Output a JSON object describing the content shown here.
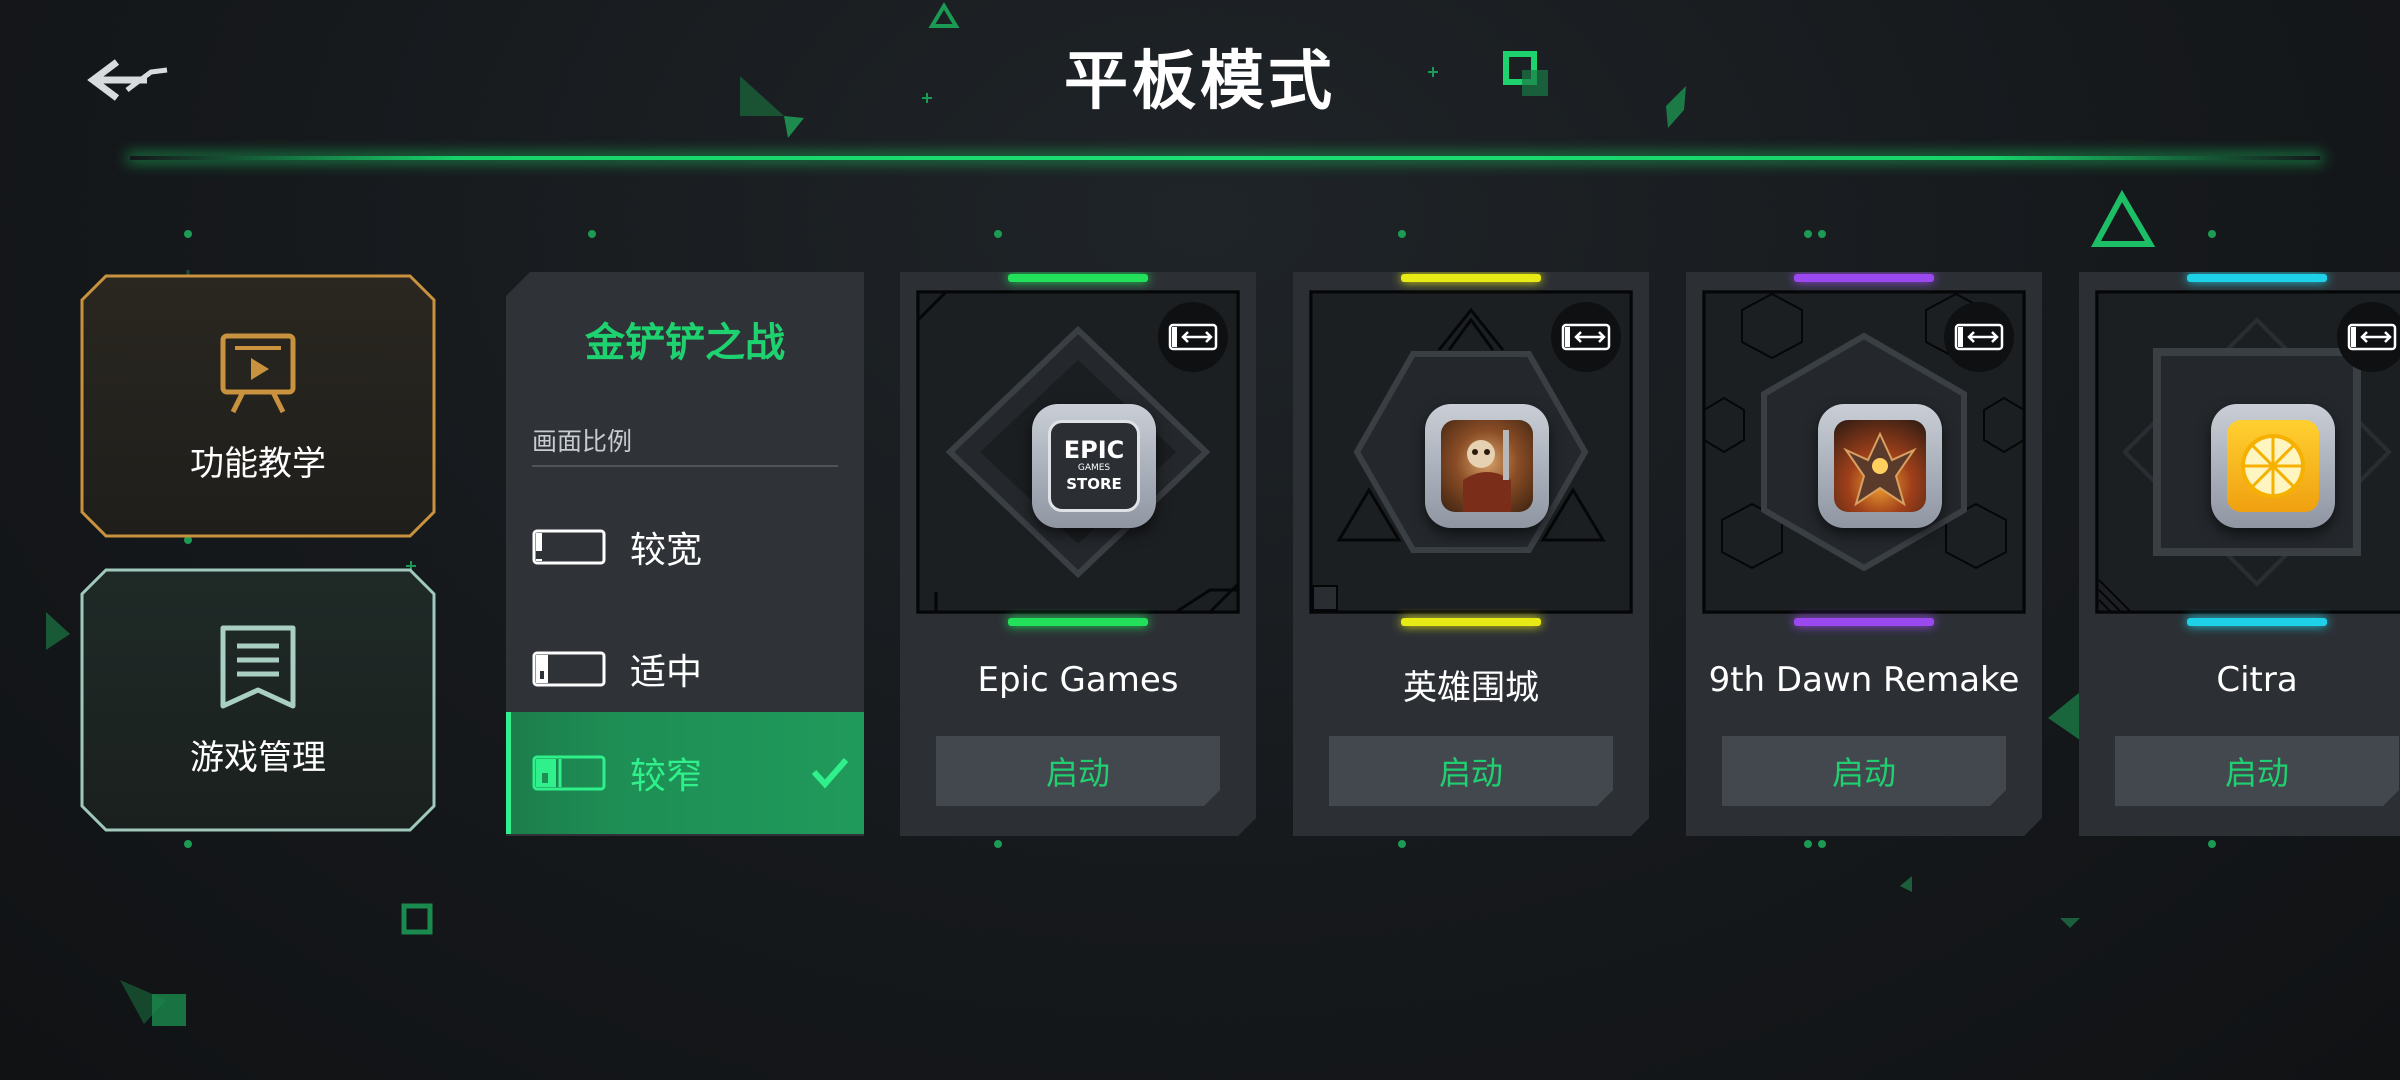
{
  "header": {
    "title": "平板模式",
    "back_icon": "back-arrow-icon"
  },
  "side_menu": [
    {
      "label": "功能教学",
      "icon": "presentation-board-icon",
      "accent": "#c8923e"
    },
    {
      "label": "游戏管理",
      "icon": "document-list-icon",
      "accent": "#9fc9bc"
    }
  ],
  "detail_panel": {
    "game_title": "金铲铲之战",
    "section_label": "画面比例",
    "options": [
      {
        "label": "较宽",
        "selected": false
      },
      {
        "label": "适中",
        "selected": false
      },
      {
        "label": "较窄",
        "selected": true
      }
    ]
  },
  "games": [
    {
      "name": "Epic Games",
      "launch_label": "启动",
      "accent": "#22e05a",
      "icon": "epic-games-store-icon",
      "icon_text": [
        "EPIC",
        "GAMES",
        "STORE"
      ]
    },
    {
      "name": "英雄围城",
      "launch_label": "启动",
      "accent": "#e8ea16",
      "icon": "hero-siege-game-icon"
    },
    {
      "name": "9th Dawn Remake",
      "launch_label": "启动",
      "accent": "#9b48f0",
      "icon": "9th-dawn-game-icon"
    },
    {
      "name": "Citra",
      "launch_label": "启动",
      "accent": "#1ed0e8",
      "icon": "citra-lemon-icon"
    }
  ],
  "colors": {
    "brand_green": "#1fd270",
    "panel_bg": "#2f3338",
    "card_bg": "#2c3035"
  }
}
